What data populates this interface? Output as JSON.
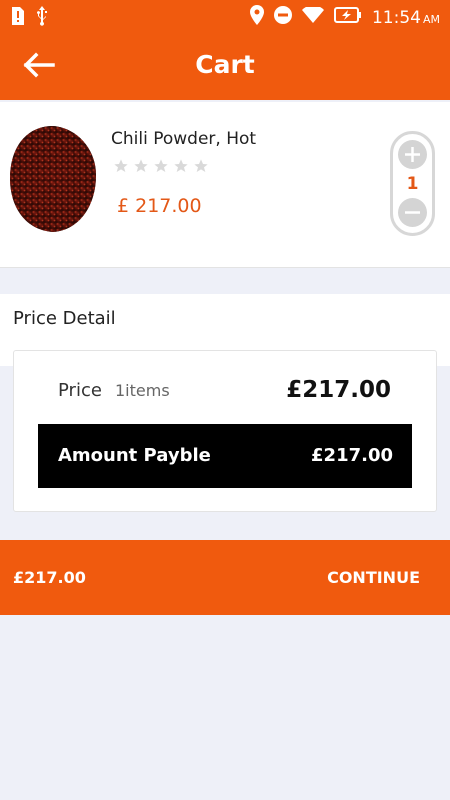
{
  "status_bar": {
    "time": "11:54",
    "ampm": "AM",
    "icons": [
      "sim-alert-icon",
      "usb-icon",
      "location-icon",
      "do-not-disturb-icon",
      "wifi-icon",
      "battery-charging-icon"
    ]
  },
  "app_bar": {
    "title": "Cart",
    "back_icon": "arrow-left-icon"
  },
  "cart_item": {
    "name": "Chili Powder, Hot",
    "price": "£ 217.00",
    "rating": 0,
    "rating_max": 5,
    "quantity": "1"
  },
  "price_detail": {
    "title": "Price Detail",
    "price_label": "Price",
    "items_label": "1items",
    "price_value": "£217.00",
    "amount_label": "Amount Payble",
    "amount_value": "£217.00"
  },
  "bottom_bar": {
    "total": "£217.00",
    "continue_label": "CONTINUE"
  },
  "colors": {
    "primary": "#f05a0e",
    "price_accent": "#e35817",
    "background": "#eef0f8"
  }
}
